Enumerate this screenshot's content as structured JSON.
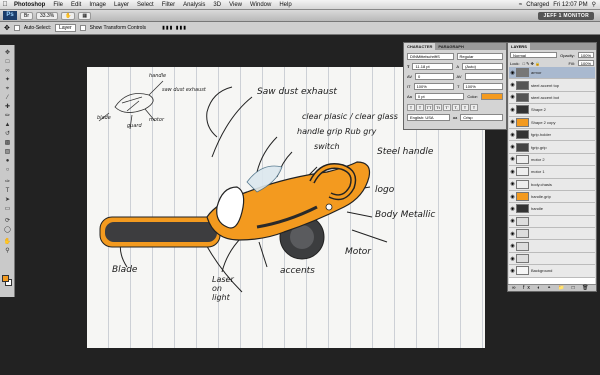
{
  "menubar": {
    "app": "Photoshop",
    "items": [
      "File",
      "Edit",
      "Image",
      "Layer",
      "Select",
      "Filter",
      "Analysis",
      "3D",
      "View",
      "Window",
      "Help"
    ],
    "battery": "Charged",
    "clock": "Fri 12:07 PM"
  },
  "appbar": {
    "logo": "Ps",
    "zoom": "33.3%",
    "workspace": "JEFF 1 MONITOR"
  },
  "options": {
    "auto_select_label": "Auto-Select:",
    "auto_select_value": "Layer",
    "transform_label": "Show Transform Controls"
  },
  "character_panel": {
    "tabs": [
      "CHARACTER",
      "PARAGRAPH"
    ],
    "font": "DINMittelschriftS",
    "style": "Regular",
    "size": "11.18 pt",
    "leading": "(Auto)",
    "kerning": "0",
    "vscale": "100%",
    "hscale": "100%",
    "baseline": "0 pt",
    "color_label": "Color:",
    "color": "#f39a1f",
    "language": "English: USA",
    "aa": "Crisp"
  },
  "layers_panel": {
    "tab": "LAYERS",
    "blend": "Normal",
    "opacity_label": "Opacity:",
    "opacity": "100%",
    "lock_label": "Lock:",
    "fill_label": "Fill:",
    "fill": "100%",
    "layers": [
      {
        "name": "armor",
        "selected": true,
        "thumb": "#777"
      },
      {
        "name": "steel accent top",
        "selected": false,
        "thumb": "#555"
      },
      {
        "name": "steel accent bot",
        "selected": false,
        "thumb": "#555"
      },
      {
        "name": "Shape 2",
        "selected": false,
        "thumb": "#333"
      },
      {
        "name": "Shape 2 copy",
        "selected": false,
        "thumb": "#f39a1f"
      },
      {
        "name": "fgrip.holder",
        "selected": false,
        "thumb": "#333"
      },
      {
        "name": "fgrip.grip",
        "selected": false,
        "thumb": "#444"
      },
      {
        "name": "motor 2",
        "selected": false,
        "thumb": "#eee"
      },
      {
        "name": "motor 1",
        "selected": false,
        "thumb": "#eee"
      },
      {
        "name": "body.chasis",
        "selected": false,
        "thumb": "#eee"
      },
      {
        "name": "handle.grip",
        "selected": false,
        "thumb": "#f39a1f"
      },
      {
        "name": "handle",
        "selected": false,
        "thumb": "#333"
      },
      {
        "name": "",
        "selected": false,
        "thumb": "#ddd"
      },
      {
        "name": "",
        "selected": false,
        "thumb": "#ddd"
      },
      {
        "name": "",
        "selected": false,
        "thumb": "#ddd"
      },
      {
        "name": "",
        "selected": false,
        "thumb": "#ddd"
      },
      {
        "name": "Background",
        "selected": false,
        "thumb": "#f6f6f6"
      }
    ]
  },
  "sketch_notes": {
    "saw_dust": "Saw dust exhaust",
    "clear_glass": "clear plasic / clear glass",
    "handle_grip": "handle grip Rub gry",
    "switch": "switch",
    "steel_handle": "Steel handle",
    "logo": "logo",
    "body_metallic": "Body Metallic",
    "motor": "Motor",
    "accents": "accents",
    "laser": "Laser on light",
    "blade": "Blade",
    "thumb_handle": "handle",
    "thumb_saw": "saw dust exhaust",
    "thumb_blade": "blade",
    "thumb_guard": "guard",
    "thumb_motor": "motor"
  }
}
